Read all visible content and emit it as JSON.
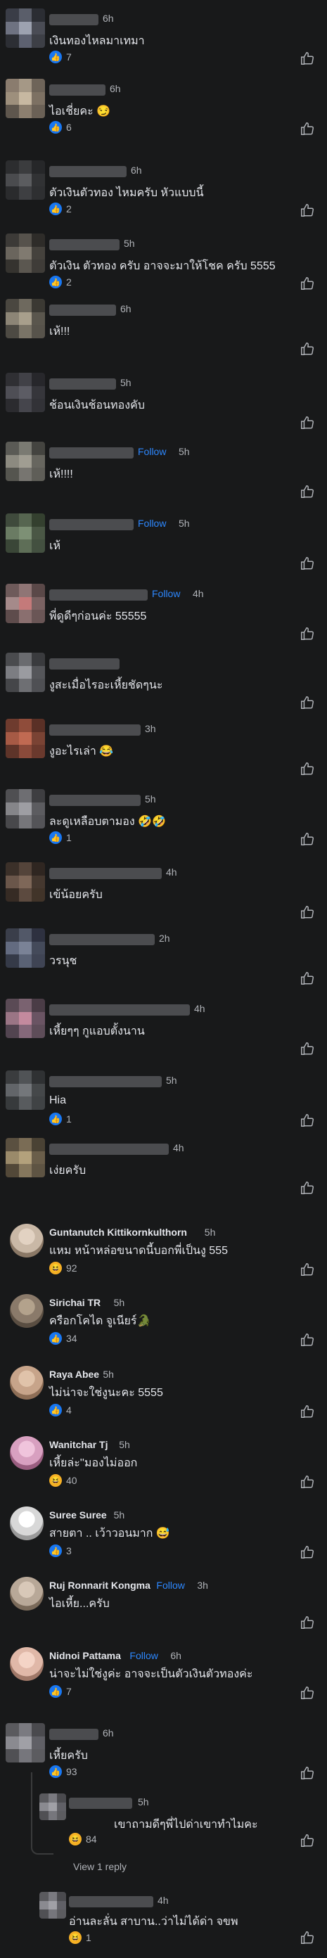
{
  "colors": {
    "background": "#18191a",
    "text": "#e4e6eb",
    "muted": "#b0b3b8",
    "accent": "#2d88ff",
    "like": "#1877f2"
  },
  "icons": {
    "like": "thumbs-up-icon",
    "haha": "laughing-emoji-icon"
  },
  "comments": [
    {
      "time": "6h",
      "text": "เงินทองไหลมาเทมา",
      "reaction": "like",
      "count": "7",
      "avatar": [
        "#3a3d47",
        "#5a5e6a",
        "#2b2d33",
        "#6e7281",
        "#9da2b0",
        "#4a4c55",
        "#2c2e34",
        "#5d6170",
        "#3d3f46"
      ]
    },
    {
      "time": "6h",
      "text": "ไอเชี่ยคะ 😏",
      "reaction": "like",
      "count": "6",
      "avatar": [
        "#8a7c6e",
        "#a59886",
        "#6e6459",
        "#9d8f7c",
        "#c7b8a1",
        "#7d7163",
        "#5e564d",
        "#8c7f6f",
        "#6b6156"
      ]
    },
    {
      "time": "6h",
      "text": "ตัวเงินตัวทอง ไหมครับ หัวแบบนี้",
      "reaction": "like",
      "count": "2",
      "avatar": [
        "#2c2d2f",
        "#3b3c3e",
        "#262729",
        "#4a4b4e",
        "#5b5c5f",
        "#313234",
        "#2a2b2d",
        "#3e3f42",
        "#2e2f31"
      ]
    },
    {
      "time": "5h",
      "text": "ตัวเงิน ตัวทอง ครับ อาจจะมาให้โชค ครับ 5555",
      "reaction": "like",
      "count": "2",
      "avatar": [
        "#3c3a37",
        "#56524c",
        "#2e2c29",
        "#6a655d",
        "#807a70",
        "#45423d",
        "#35332f",
        "#5b5750",
        "#3f3c38"
      ]
    },
    {
      "time": "6h",
      "text": "เห้!!!",
      "avatar": [
        "#4a4740",
        "#6e695e",
        "#3b3933",
        "#8c8576",
        "#a89f8c",
        "#5a564d",
        "#4d4a43",
        "#7a7467",
        "#57534b"
      ]
    },
    {
      "time": "5h",
      "text": "ช้อนเงินช้อนทองคับ",
      "avatar": [
        "#2f2f33",
        "#414147",
        "#27272b",
        "#4e4e55",
        "#5c5c64",
        "#36363b",
        "#2b2b2f",
        "#45454c",
        "#323237"
      ]
    },
    {
      "time": "5h",
      "follow": "Follow",
      "text": "เห้!!!!",
      "avatar": [
        "#5a5a55",
        "#7a7a72",
        "#444440",
        "#8c8a80",
        "#a09d92",
        "#67665f",
        "#55554f",
        "#777570",
        "#5f5e58"
      ]
    },
    {
      "time": "5h",
      "follow": "Follow",
      "text": "เห้",
      "avatar": [
        "#3f4a3c",
        "#566550",
        "#34402f",
        "#6a7b63",
        "#7d9075",
        "#4a5745",
        "#3a4637",
        "#5e6e57",
        "#435040"
      ]
    },
    {
      "time": "4h",
      "follow": "Follow",
      "text": "พี่ดูดีๆก่อนค่ะ 55555",
      "avatar": [
        "#6e5a5a",
        "#8f7575",
        "#5a4848",
        "#a58a8a",
        "#c47a7a",
        "#7a6262",
        "#5e4c4c",
        "#8a6f6f",
        "#6a5656"
      ]
    },
    {
      "time": "",
      "text": "งูสะเมื่อไรอะเหี้ยชัดๆนะ",
      "avatar": [
        "#4a4b4e",
        "#6a6b6f",
        "#3a3b3e",
        "#7c7d82",
        "#9a9ba0",
        "#55565a",
        "#454649",
        "#6e6f73",
        "#4f5054"
      ]
    },
    {
      "time": "3h",
      "text": "งูอะไรเล่า 😂",
      "avatar": [
        "#6e3b2e",
        "#8f4c3a",
        "#5a3026",
        "#a65a45",
        "#c06a52",
        "#7a4334",
        "#5e3429",
        "#8a4a3a",
        "#6a392d"
      ]
    },
    {
      "time": "5h",
      "text": "ละดูเหลือบตามอง 🤣🤣",
      "reaction": "like",
      "count": "1",
      "avatar": [
        "#4f4f52",
        "#6e6e72",
        "#3e3e41",
        "#858589",
        "#9e9ea3",
        "#5c5c60",
        "#48484b",
        "#76767a",
        "#545458"
      ]
    },
    {
      "time": "4h",
      "text": "เข้น้อยครับ",
      "avatar": [
        "#3b3029",
        "#54443a",
        "#2f2621",
        "#6a564a",
        "#7e6758",
        "#45382f",
        "#362b24",
        "#5c4a3f",
        "#413429"
      ]
    },
    {
      "time": "2h",
      "text": "วรนุช",
      "avatar": [
        "#3a3e4a",
        "#525868",
        "#2e3140",
        "#636b80",
        "#7a8296",
        "#444a5a",
        "#353a48",
        "#5a6275",
        "#3f4454"
      ]
    },
    {
      "time": "4h",
      "text": "เหี้ยๆๆ กูแอบตั้งนาน",
      "avatar": [
        "#5a4a55",
        "#7a6270",
        "#4a3c46",
        "#9a7585",
        "#c48a9e",
        "#6a5463",
        "#524450",
        "#85687a",
        "#5e4d59"
      ]
    },
    {
      "time": "5h",
      "text": "Hia",
      "reaction": "like",
      "count": "1",
      "avatar": [
        "#3a3c3e",
        "#505356",
        "#2f3133",
        "#626569",
        "#74777b",
        "#45484a",
        "#373a3c",
        "#585b5e",
        "#404345"
      ]
    },
    {
      "time": "4h",
      "text": "เง่ยครับ",
      "avatar": [
        "#5a5040",
        "#7a6c55",
        "#4a4234",
        "#9a8a6a",
        "#b3a17c",
        "#6a5e4a",
        "#524838",
        "#85775d",
        "#5e5443"
      ]
    }
  ],
  "named": [
    {
      "name": "Guntanutch Kittikornkulthorn",
      "time": "5h",
      "text": "แหม  หน้าหล่อขนาดนี้บอกพี่เป็นงู  555",
      "reaction": "haha",
      "count": "92"
    },
    {
      "name": "Sirichai TR",
      "time": "5h",
      "text": "ครือกโคได จูเนียร์🐊",
      "reaction": "like",
      "count": "34"
    },
    {
      "name": "Raya Abee",
      "time": "5h",
      "text": "ไม่น่าจะใช่งูนะคะ 5555",
      "reaction": "like",
      "count": "4"
    },
    {
      "name": "Wanitchar Tj",
      "time": "5h",
      "text": "เหี้ยล่ะ''มองไม่ออก",
      "reaction": "haha",
      "count": "40"
    },
    {
      "name": "Suree Suree",
      "time": "5h",
      "text": "สายตา .. เว้าวอนมาก 😅",
      "reaction": "like",
      "count": "3"
    },
    {
      "name": "Ruj Ronnarit Kongma",
      "follow": "Follow",
      "time": "3h",
      "text": "ไอเหี้ย...ครับ"
    },
    {
      "name": "Nidnoi Pattama",
      "follow": "Follow",
      "time": "6h",
      "text": "น่าจะไม่ใช่งูค่ะ อาจจะเป็นตัวเงินตัวทองค่ะ",
      "reaction": "like",
      "count": "7"
    }
  ],
  "tail": [
    {
      "time": "6h",
      "text": "เหี้ยครับ",
      "reaction": "like",
      "count": "93"
    },
    {
      "time": "5h",
      "text": "เขาถามดีๆพี่ไปด่าเขาทำไมคะ",
      "reaction": "haha",
      "count": "84"
    },
    {
      "time": "4h",
      "text": "อ่านละลั่น สาบาน..ว่าไม่ได้ด่า จขพ",
      "reaction": "haha",
      "count": "1"
    }
  ],
  "view_replies": "View 1 reply"
}
